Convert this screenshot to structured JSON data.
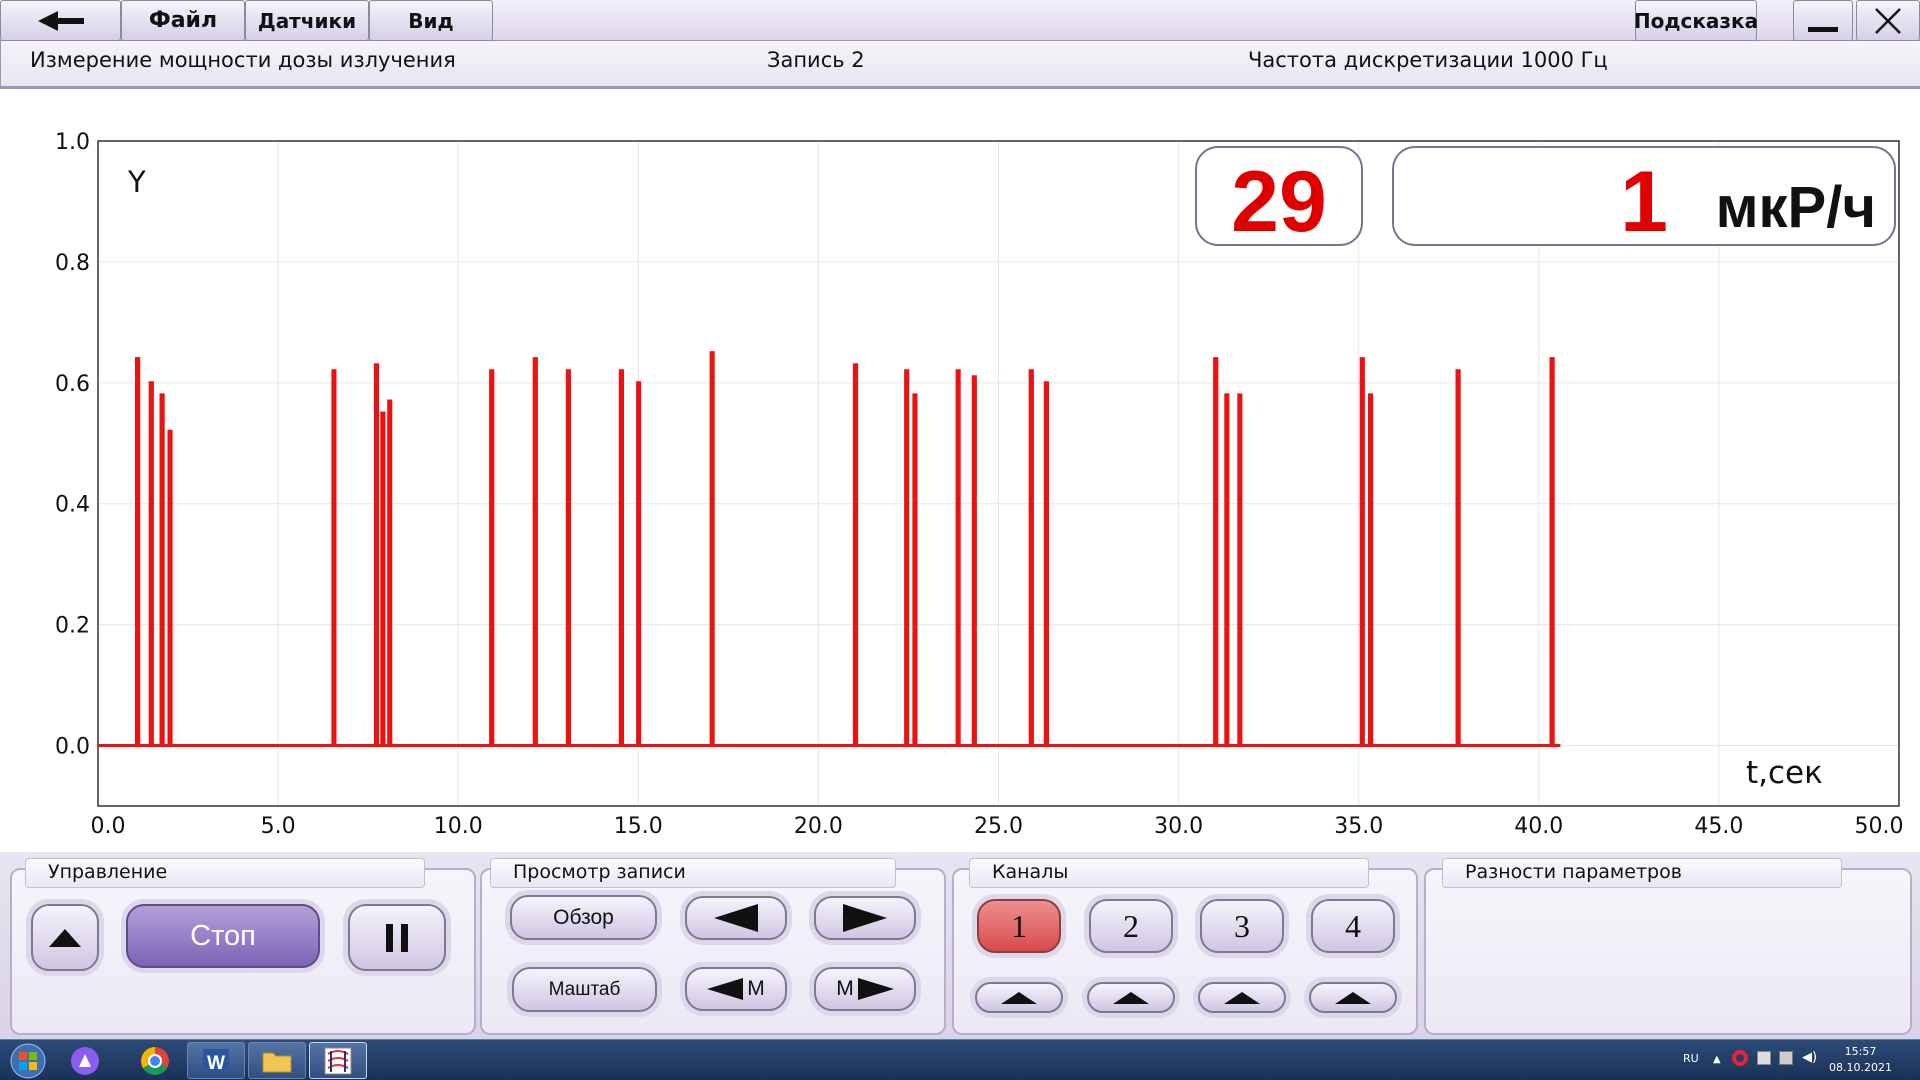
{
  "menu": {
    "file": "Файл",
    "sensors": "Датчики",
    "view": "Вид",
    "hint": "Подсказка"
  },
  "info": {
    "measurement": "Измерение мощности дозы излучения",
    "record": "Запись 2",
    "sample_rate": "Частота дискретизации 1000 Гц"
  },
  "display": {
    "count": "29",
    "dose_value": "1",
    "dose_unit": "мкР/ч"
  },
  "colors": {
    "trace": "#ee1111",
    "display_value": "#e00000",
    "grid": "#e6e6e6"
  },
  "chart_data": {
    "type": "line",
    "xlabel": "t,сек",
    "ylabel": "Y",
    "xlim": [
      0,
      50
    ],
    "ylim": [
      -0.1,
      1.0
    ],
    "x_ticks": [
      "0.0",
      "5.0",
      "10.0",
      "15.0",
      "20.0",
      "25.0",
      "30.0",
      "35.0",
      "40.0",
      "45.0",
      "50.0"
    ],
    "y_ticks": [
      "0.0",
      "0.2",
      "0.4",
      "0.6",
      "0.8",
      "1.0"
    ],
    "grid": true,
    "series": [
      {
        "pulses": [
          {
            "t": 1.07,
            "v": 0.64
          },
          {
            "t": 1.45,
            "v": 0.6
          },
          {
            "t": 1.75,
            "v": 0.58
          },
          {
            "t": 1.97,
            "v": 0.52
          },
          {
            "t": 6.52,
            "v": 0.62
          },
          {
            "t": 7.7,
            "v": 0.63
          },
          {
            "t": 7.88,
            "v": 0.55
          },
          {
            "t": 8.07,
            "v": 0.57
          },
          {
            "t": 10.9,
            "v": 0.62
          },
          {
            "t": 12.11,
            "v": 0.64
          },
          {
            "t": 13.03,
            "v": 0.62
          },
          {
            "t": 14.5,
            "v": 0.62
          },
          {
            "t": 14.98,
            "v": 0.6
          },
          {
            "t": 17.02,
            "v": 0.65
          },
          {
            "t": 21.0,
            "v": 0.63
          },
          {
            "t": 22.42,
            "v": 0.62
          },
          {
            "t": 22.65,
            "v": 0.58
          },
          {
            "t": 23.85,
            "v": 0.62
          },
          {
            "t": 24.3,
            "v": 0.61
          },
          {
            "t": 25.88,
            "v": 0.62
          },
          {
            "t": 26.3,
            "v": 0.6
          },
          {
            "t": 31.0,
            "v": 0.64
          },
          {
            "t": 31.31,
            "v": 0.58
          },
          {
            "t": 31.67,
            "v": 0.58
          },
          {
            "t": 35.07,
            "v": 0.64
          },
          {
            "t": 35.3,
            "v": 0.58
          },
          {
            "t": 37.73,
            "v": 0.62
          },
          {
            "t": 40.34,
            "v": 0.64
          }
        ],
        "baseline": 0.0,
        "end_t": 40.6
      }
    ]
  },
  "panel": {
    "control": {
      "title": "Управление",
      "stop": "Стоп"
    },
    "view": {
      "title": "Просмотр записи",
      "overview": "Обзор",
      "scale": "Маштаб",
      "m": "М"
    },
    "channels": {
      "title": "Каналы",
      "items": [
        "1",
        "2",
        "3",
        "4"
      ],
      "active": "1"
    },
    "diff": {
      "title": "Разности параметров"
    }
  },
  "taskbar": {
    "lang": "RU",
    "time": "15:57",
    "date": "08.10.2021",
    "apps": [
      "start-orb",
      "alice-icon",
      "chrome-icon",
      "word-icon",
      "explorer-icon",
      "app-icon"
    ]
  }
}
